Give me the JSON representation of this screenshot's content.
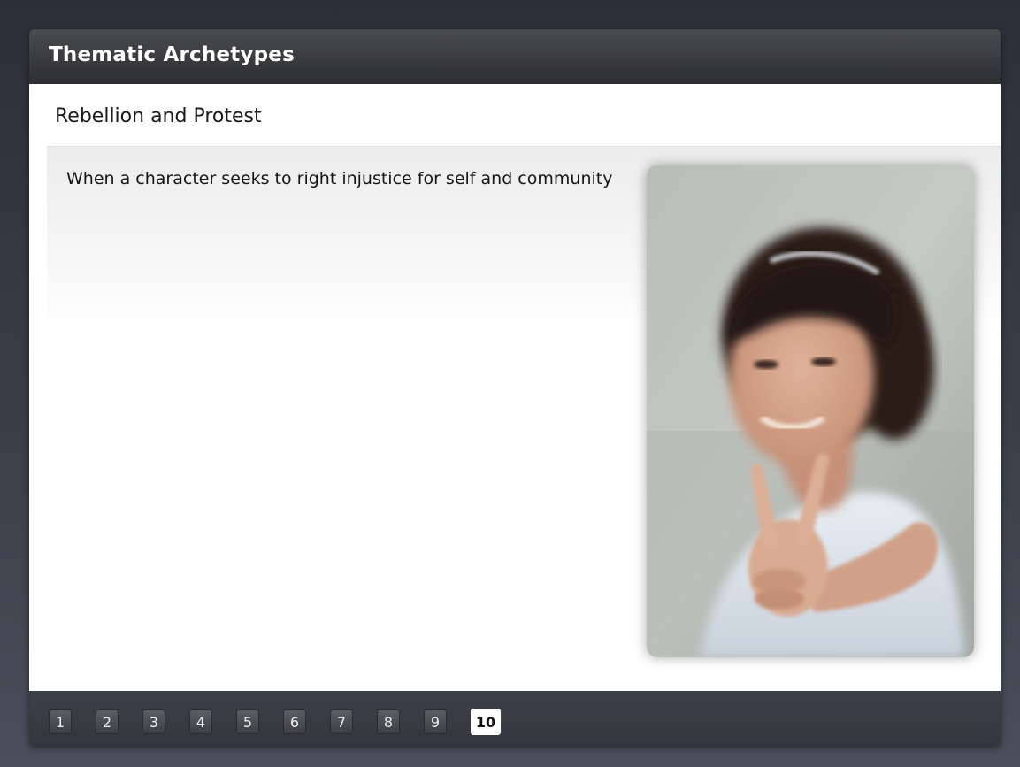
{
  "header": {
    "title": "Thematic Archetypes"
  },
  "main": {
    "subtitle": "Rebellion and Protest",
    "description": "When a character seeks to right injustice for self and community"
  },
  "pagination": {
    "pages": [
      "1",
      "2",
      "3",
      "4",
      "5",
      "6",
      "7",
      "8",
      "9",
      "10"
    ],
    "current": "10"
  },
  "colors": {
    "background": "#33363d",
    "title_bar": "#2d2e31",
    "active_page": "#ffffff"
  }
}
